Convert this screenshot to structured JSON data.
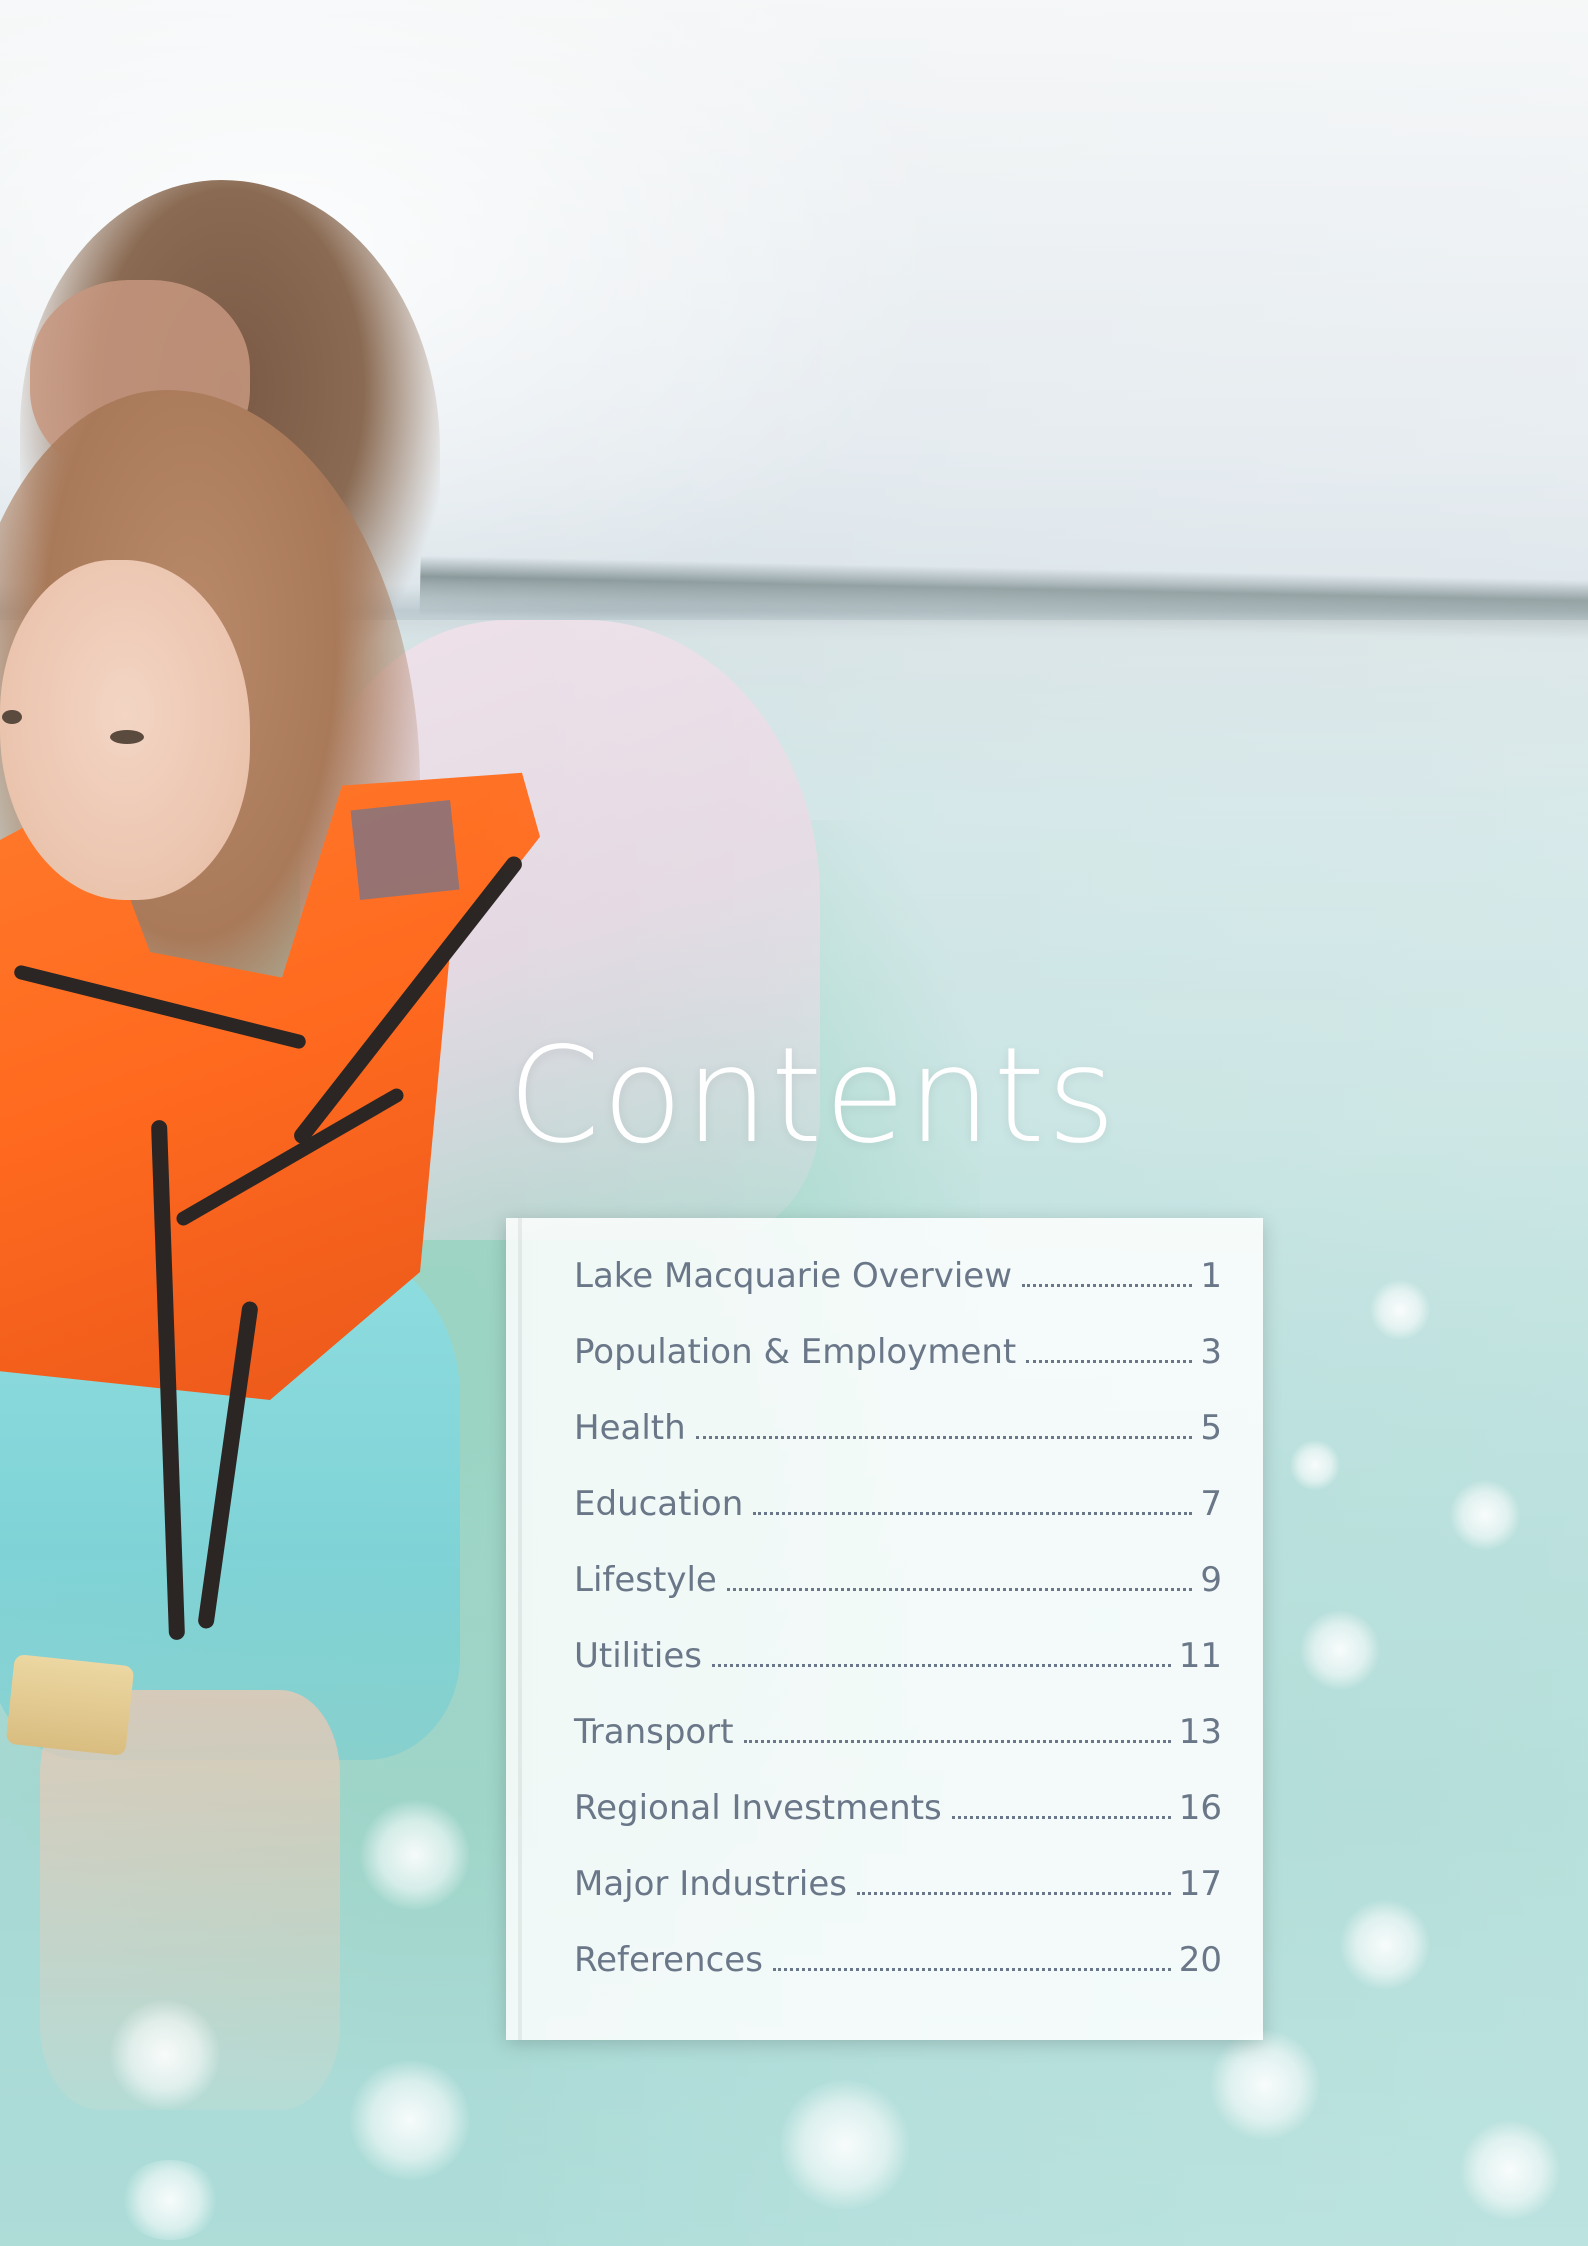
{
  "page": {
    "title": "Contents"
  },
  "toc": {
    "items": [
      {
        "label": "Lake Macquarie Overview",
        "page": "1"
      },
      {
        "label": "Population & Employment",
        "page": "3"
      },
      {
        "label": "Health",
        "page": "5"
      },
      {
        "label": "Education",
        "page": "7"
      },
      {
        "label": "Lifestyle",
        "page": "9"
      },
      {
        "label": "Utilities",
        "page": "11"
      },
      {
        "label": "Transport",
        "page": "13"
      },
      {
        "label": "Regional Investments",
        "page": "16"
      },
      {
        "label": "Major Industries",
        "page": "17"
      },
      {
        "label": "References",
        "page": "20"
      }
    ]
  },
  "colors": {
    "title_text": "#ffffff",
    "toc_text": "#6a7788",
    "vest": "#ff6a1f",
    "water": "#b0dcd8"
  }
}
